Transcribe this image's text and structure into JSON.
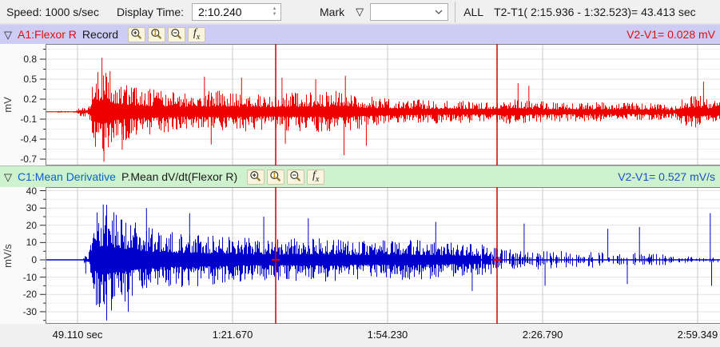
{
  "toolbar": {
    "speed_label": "Speed: 1000 s/sec",
    "display_time_label": "Display Time:",
    "display_time_value": "2:10.240",
    "mark_label": "Mark",
    "mark_dropdown_value": "",
    "all_label": "ALL",
    "t2t1_text": "T2-T1( 2:15.936 -  1:32.523)= 43.413 sec"
  },
  "channels": [
    {
      "id": "A1",
      "title": "A1:Flexor R",
      "mode": "Record",
      "delta_label": "V2-V1= 0.028 mV",
      "title_color": "#e01010",
      "header_bg": "#cdccf4",
      "unit": "mV"
    },
    {
      "id": "C1",
      "title": "C1:Mean Derivative",
      "mode": "P.Mean dV/dt(Flexor R)",
      "delta_label": "V2-V1= 0.527 mV/s",
      "title_color": "#0b62c8",
      "header_bg": "#cef2ce",
      "unit": "mV/s"
    }
  ],
  "icons": {
    "fx_f": "f",
    "fx_x": "x"
  },
  "grid": {
    "minor_color": "#efefef",
    "major_color": "#e2e2e2",
    "vertical_color": "#c8c8c8",
    "border_color": "#808080"
  },
  "cursors": {
    "fracs": [
      0.3412,
      0.6694
    ],
    "color": "#d40000"
  },
  "time_axis": {
    "labels": [
      "49.110 sec",
      "1:21.670",
      "1:54.230",
      "2:26.790",
      "2:59.349"
    ],
    "tick_fracs": [
      0.0474,
      0.2773,
      0.5071,
      0.737,
      0.9668
    ]
  },
  "chart_data": [
    {
      "id": "A1",
      "type": "line",
      "title": "A1:Flexor R EMG",
      "ylabel": "mV",
      "ylim": [
        -0.796,
        1.028
      ],
      "ytick_values": [
        0.8,
        0.5,
        0.2,
        -0.1,
        -0.4,
        -0.7
      ],
      "ytick_labels": [
        "0.8",
        "0.5",
        "0.2",
        "-0.1",
        "-0.4",
        "-0.7"
      ],
      "x_labels": [
        "49.110 sec",
        "1:21.670",
        "1:54.230",
        "2:26.790",
        "2:59.349"
      ],
      "baseline": 0.01,
      "color": "#ee0000",
      "seed": 20240501,
      "envelope": [
        [
          0,
          0.012
        ],
        [
          0.044,
          0.012
        ],
        [
          0.048,
          0.07
        ],
        [
          0.058,
          0.07
        ],
        [
          0.061,
          0.03
        ],
        [
          0.066,
          0.2
        ],
        [
          0.072,
          0.6
        ],
        [
          0.085,
          0.72
        ],
        [
          0.1,
          0.5
        ],
        [
          0.125,
          0.4
        ],
        [
          0.155,
          0.34
        ],
        [
          0.2,
          0.3
        ],
        [
          0.26,
          0.32
        ],
        [
          0.32,
          0.28
        ],
        [
          0.38,
          0.29
        ],
        [
          0.44,
          0.32
        ],
        [
          0.47,
          0.24
        ],
        [
          0.52,
          0.19
        ],
        [
          0.6,
          0.17
        ],
        [
          0.66,
          0.16
        ],
        [
          0.7,
          0.22
        ],
        [
          0.72,
          0.16
        ],
        [
          0.76,
          0.15
        ],
        [
          0.86,
          0.14
        ],
        [
          0.91,
          0.13
        ],
        [
          0.932,
          0.09
        ],
        [
          0.945,
          0.22
        ],
        [
          0.97,
          0.26
        ],
        [
          0.985,
          0.18
        ],
        [
          1,
          0.17
        ]
      ],
      "spikes": [
        [
          0.083,
          0.82
        ],
        [
          0.086,
          -0.74
        ],
        [
          0.095,
          0.62
        ],
        [
          0.113,
          -0.56
        ],
        [
          0.235,
          0.54
        ],
        [
          0.245,
          -0.48
        ],
        [
          0.29,
          0.52
        ],
        [
          0.35,
          0.52
        ],
        [
          0.355,
          -0.47
        ],
        [
          0.4,
          0.5
        ],
        [
          0.442,
          -0.64
        ],
        [
          0.444,
          0.55
        ],
        [
          0.475,
          -0.5
        ],
        [
          0.7,
          0.44
        ],
        [
          0.716,
          0.4
        ],
        [
          0.975,
          0.46
        ]
      ],
      "density": [
        [
          0,
          1
        ],
        [
          1,
          1
        ]
      ],
      "cursor_plus": false
    },
    {
      "id": "C1",
      "type": "line",
      "title": "C1:Mean dV/dt(Flexor R)",
      "ylabel": "mV/s",
      "ylim": [
        -37.0,
        42.1
      ],
      "ytick_values": [
        40,
        30,
        20,
        10,
        0,
        -10,
        -20,
        -30
      ],
      "ytick_labels": [
        "40",
        "30",
        "20",
        "10",
        "0",
        "-10",
        "-20",
        "-30"
      ],
      "x_labels": [
        "49.110 sec",
        "1:21.670",
        "1:54.230",
        "2:26.790",
        "2:59.349"
      ],
      "baseline": 0,
      "color": "#0000cc",
      "seed": 777013,
      "envelope": [
        [
          0,
          0.25
        ],
        [
          0.055,
          0.25
        ],
        [
          0.058,
          3
        ],
        [
          0.062,
          1
        ],
        [
          0.068,
          12
        ],
        [
          0.075,
          30
        ],
        [
          0.088,
          33
        ],
        [
          0.105,
          28
        ],
        [
          0.135,
          22
        ],
        [
          0.17,
          16
        ],
        [
          0.22,
          16
        ],
        [
          0.28,
          13
        ],
        [
          0.34,
          12
        ],
        [
          0.41,
          13
        ],
        [
          0.47,
          11
        ],
        [
          0.54,
          12
        ],
        [
          0.6,
          10
        ],
        [
          0.655,
          9
        ],
        [
          0.675,
          6.5
        ],
        [
          0.74,
          5.5
        ],
        [
          0.81,
          4.5
        ],
        [
          0.88,
          4
        ],
        [
          0.94,
          3
        ],
        [
          0.967,
          1.2
        ],
        [
          0.982,
          2
        ],
        [
          1,
          1.5
        ]
      ],
      "spikes": [
        [
          0.059,
          -8
        ],
        [
          0.085,
          32
        ],
        [
          0.09,
          -35
        ],
        [
          0.122,
          -30
        ],
        [
          0.149,
          30
        ],
        [
          0.213,
          27
        ],
        [
          0.323,
          25
        ],
        [
          0.389,
          24
        ],
        [
          0.578,
          22
        ],
        [
          0.632,
          -18
        ],
        [
          0.709,
          21
        ],
        [
          0.74,
          -15
        ],
        [
          0.833,
          18
        ],
        [
          0.862,
          -14
        ],
        [
          0.88,
          19
        ],
        [
          0.985,
          27
        ],
        [
          0.987,
          -15
        ]
      ],
      "density": [
        [
          0,
          1
        ],
        [
          0.64,
          1
        ],
        [
          0.68,
          0.6
        ],
        [
          0.78,
          0.5
        ],
        [
          0.9,
          0.42
        ],
        [
          1,
          0.38
        ]
      ],
      "cursor_plus": true
    }
  ]
}
